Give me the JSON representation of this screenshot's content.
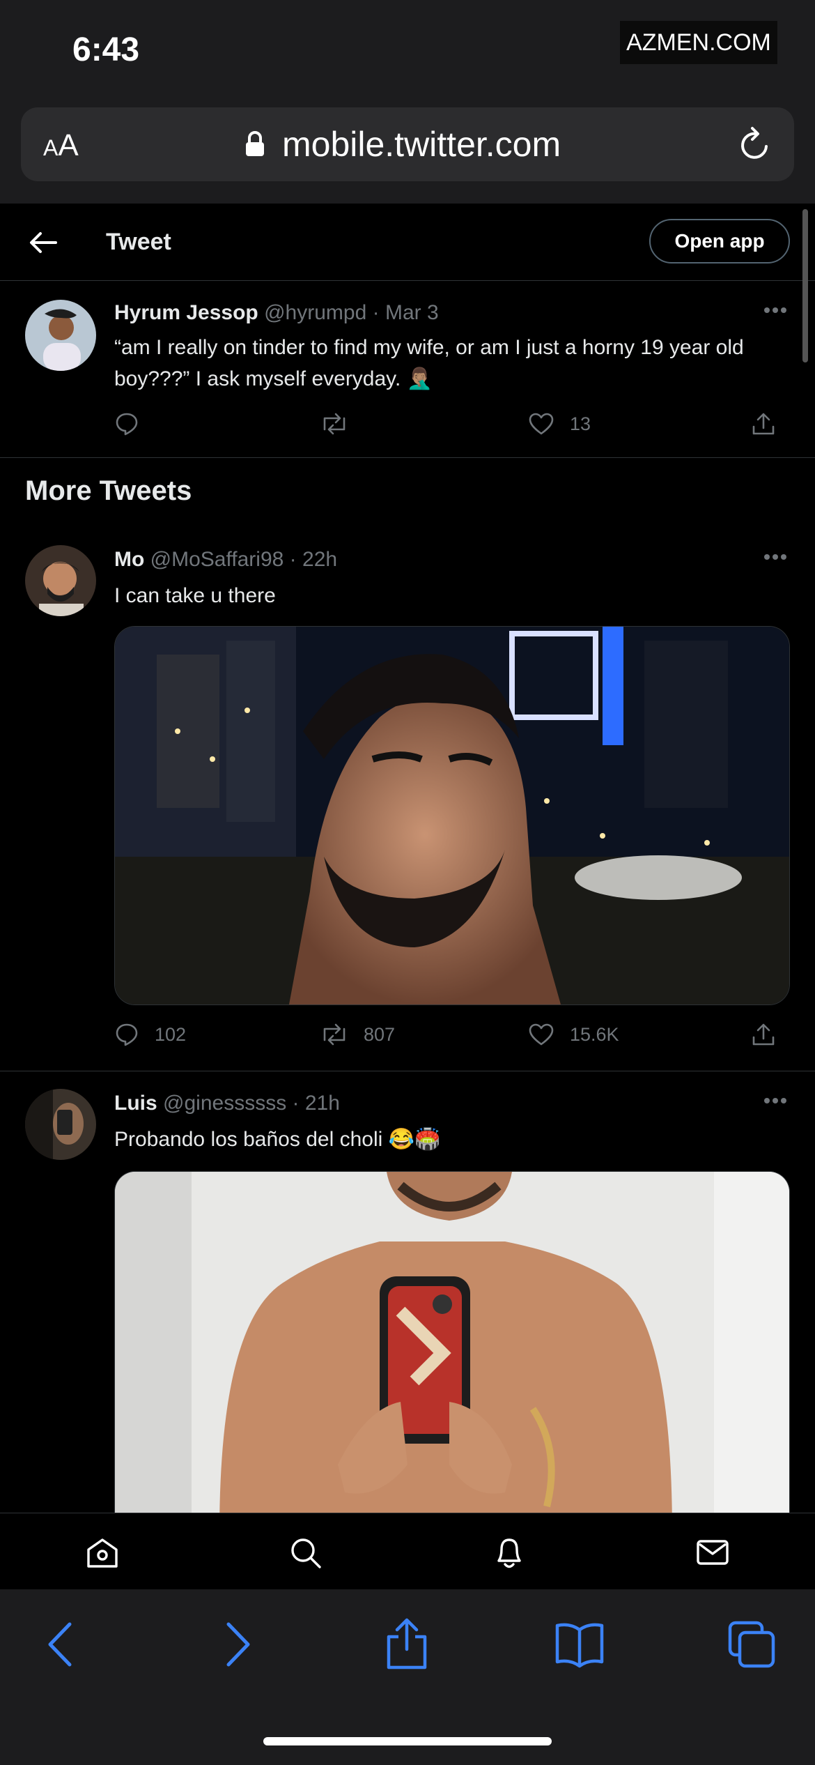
{
  "status_bar": {
    "time": "6:43",
    "watermark": "AZMEN.COM"
  },
  "browser": {
    "text_size_label_small": "A",
    "text_size_label_large": "A",
    "url": "mobile.twitter.com"
  },
  "header": {
    "title": "Tweet",
    "open_app_label": "Open app"
  },
  "main_tweet": {
    "name": "Hyrum Jessop",
    "handle": "@hyrumpd",
    "date": "Mar 3",
    "text_line1": "“am I really on tinder to find my wife, or am I just a horny 19 year old",
    "text_line2": "boy???”  I ask myself everyday. 🤦🏽‍♂️",
    "likes": "13"
  },
  "more_tweets_title": "More Tweets",
  "tweets": [
    {
      "name": "Mo",
      "handle": "@MoSaffari98",
      "time": "22h",
      "text": "I can take u there",
      "replies": "102",
      "retweets": "807",
      "likes": "15.6K"
    },
    {
      "name": "Luis",
      "handle": "@ginessssss",
      "time": "21h",
      "text": "Probando los baños del choli 😂🏟️"
    }
  ],
  "separator": " · ",
  "colors": {
    "background": "#000000",
    "text": "#e7e9ea",
    "muted": "#71767b",
    "safari_blue": "#3b82f6",
    "divider": "#2f3336"
  },
  "icons": {
    "nav": [
      "home-icon",
      "search-icon",
      "bell-icon",
      "mail-icon"
    ],
    "safari": [
      "back-icon",
      "forward-icon",
      "share-icon",
      "bookmarks-icon",
      "tabs-icon"
    ]
  }
}
